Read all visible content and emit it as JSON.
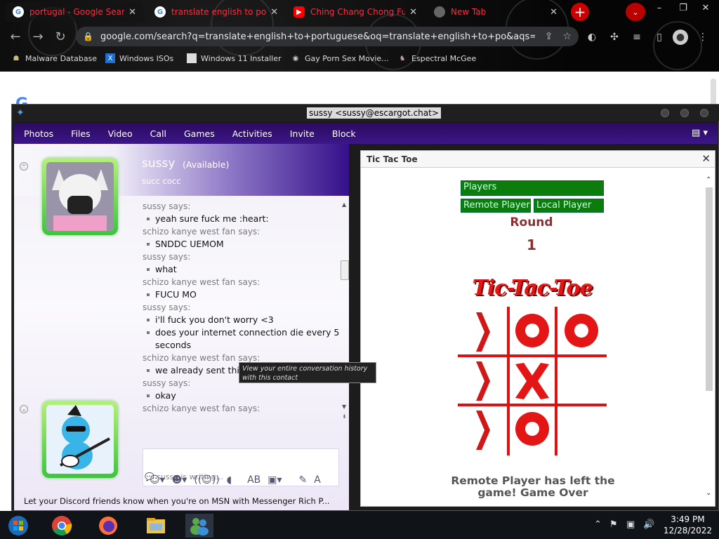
{
  "browser": {
    "tabs": [
      {
        "title": "portugal - Google Search",
        "favicon": "google-icon"
      },
      {
        "title": "translate english to portu",
        "favicon": "google-icon"
      },
      {
        "title": "Ching Chang Chong Full vi",
        "favicon": "youtube-icon"
      },
      {
        "title": "New Tab",
        "favicon": "chrome-icon"
      }
    ],
    "url": "google.com/search?q=translate+english+to+portuguese&oq=translate+english+to+po&aqs=chr...",
    "bookmarks": [
      {
        "label": "Malware Database"
      },
      {
        "label": "Windows ISOs"
      },
      {
        "label": "Windows 11 Installer"
      },
      {
        "label": "Gay Porn Sex Movie..."
      },
      {
        "label": "Espectral McGee"
      }
    ]
  },
  "messenger": {
    "window_title": "sussy <sussy@escargot.chat>",
    "menu": [
      "Photos",
      "Files",
      "Video",
      "Call",
      "Games",
      "Activities",
      "Invite",
      "Block"
    ],
    "contact": {
      "name": "sussy",
      "status": "(Available)",
      "psm": "succ cocc"
    },
    "history": [
      {
        "sender": "sussy says:",
        "messages": [
          "yeah sure fuck me :heart:"
        ]
      },
      {
        "sender": "schizo kanye west fan says:",
        "messages": [
          "SNDDC UEMOM"
        ]
      },
      {
        "sender": "sussy says:",
        "messages": [
          "what"
        ]
      },
      {
        "sender": "schizo kanye west fan says:",
        "messages": [
          "FUCU MO"
        ]
      },
      {
        "sender": "sussy says:",
        "messages": [
          "i'll fuck you don't worry <3",
          "does your internet connection die every 5 seconds"
        ]
      },
      {
        "sender": "schizo kanye west fan says:",
        "messages": [
          "we already sent this to jeff"
        ]
      },
      {
        "sender": "sussy says:",
        "messages": [
          "okay"
        ]
      },
      {
        "sender": "schizo kanye west fan says:",
        "messages": []
      }
    ],
    "tooltip": "View your entire conversation history with this contact",
    "typing": "sussy is writing...",
    "banner": "Let your Discord friends know when you're on MSN with Messenger Rich P..."
  },
  "game": {
    "title": "Tic Tac Toe",
    "players_label": "Players",
    "remote_player": "Remote Player",
    "local_player": "Local Player",
    "round_label": "Round",
    "round_number": "1",
    "logo": "Tic-Tac-Toe",
    "board": [
      "|",
      "O",
      "O",
      "|",
      "X",
      "",
      "|",
      "O",
      ""
    ],
    "status": "Remote Player has left the game! Game Over"
  },
  "taskbar": {
    "time": "3:49 PM",
    "date": "12/28/2022"
  },
  "colors": {
    "menu_bg": "#2a0a5e",
    "game_green": "#0c7d0c",
    "game_red": "#e31515",
    "round_color": "#8b2f35"
  }
}
